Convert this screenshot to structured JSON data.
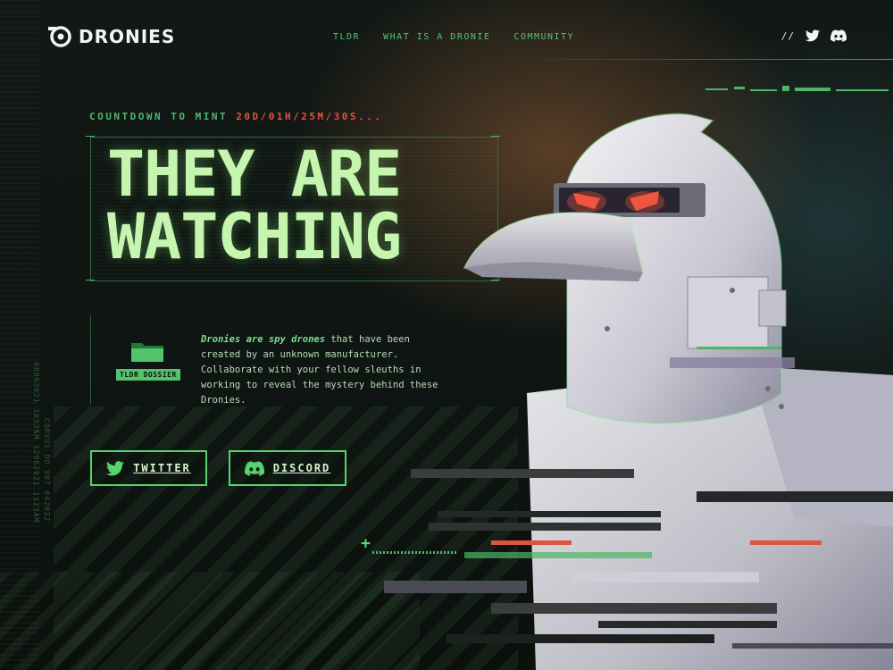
{
  "brand": {
    "name": "DRONIES"
  },
  "nav": {
    "items": [
      "TLDR",
      "WHAT IS A DRONIE",
      "COMMUNITY"
    ]
  },
  "social": {
    "separator": "//",
    "twitter_icon": "twitter-icon",
    "discord_icon": "discord-icon"
  },
  "hero": {
    "countdown_label": "COUNTDOWN TO MINT",
    "countdown_value": "20D/01H/25M/30S...",
    "title_line1": "THEY ARE",
    "title_line2": "WATCHING"
  },
  "dossier": {
    "label": "TLDR DOSSIER"
  },
  "description": {
    "emphasis": "Dronies are spy drones",
    "text": " that have been created by an unknown manufacturer. Collaborate with your fellow sleuths in working to reveal the mystery behind these Dronies."
  },
  "buttons": {
    "twitter": "TWITTER",
    "discord": "DISCORD"
  },
  "side_codes": {
    "left": "08062021 1033AM 12062021 1123AM",
    "right": "CORVUS DO V07 042022"
  },
  "colors": {
    "accent": "#56d26e",
    "title": "#c6f5b0",
    "timer": "#e0543f",
    "background": "#0e1411"
  }
}
